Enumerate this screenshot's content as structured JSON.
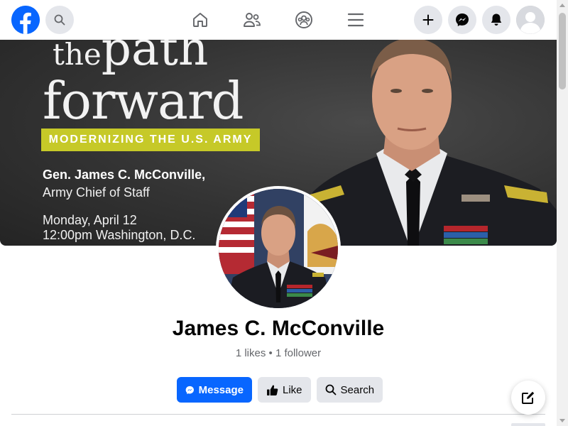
{
  "nav": {
    "logo_icon": "facebook-logo",
    "search_icon": "search-icon",
    "center_icons": [
      "home-icon",
      "friends-icon",
      "groups-icon",
      "menu-icon"
    ],
    "right_icons": [
      "plus-icon",
      "messenger-icon",
      "bell-icon",
      "avatar-icon"
    ]
  },
  "cover": {
    "title_line1_small": "the",
    "title_line1_big": "path",
    "title_line2": "forward",
    "banner": "MODERNIZING THE U.S. ARMY",
    "speaker": "Gen. James C. McConville,",
    "role": "Army Chief of Staff",
    "date": "Monday, April 12",
    "time": "12:00pm Washington, D.C.",
    "banner_color": "#c6c928"
  },
  "profile": {
    "name": "James C. McConville",
    "stats": "1 likes • 1 follower"
  },
  "actions": {
    "message_label": "Message",
    "like_label": "Like",
    "search_label": "Search"
  },
  "colors": {
    "brand": "#0866ff",
    "secondary_bg": "#e4e6eb",
    "muted_text": "#65676b"
  }
}
